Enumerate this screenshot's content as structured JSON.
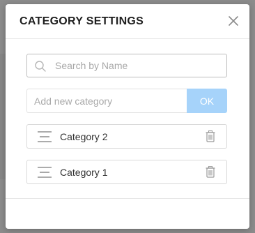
{
  "modal": {
    "title": "CATEGORY SETTINGS",
    "close_icon": "close-icon"
  },
  "search": {
    "placeholder": "Search by Name",
    "value": "",
    "icon": "search-icon"
  },
  "add_category": {
    "placeholder": "Add new category",
    "value": "",
    "ok_label": "OK",
    "ok_color": "#a6d3fa"
  },
  "categories": [
    {
      "label": "Category 2",
      "drag_icon": "drag-handle-icon",
      "delete_icon": "trash-icon"
    },
    {
      "label": "Category 1",
      "drag_icon": "drag-handle-icon",
      "delete_icon": "trash-icon"
    }
  ]
}
